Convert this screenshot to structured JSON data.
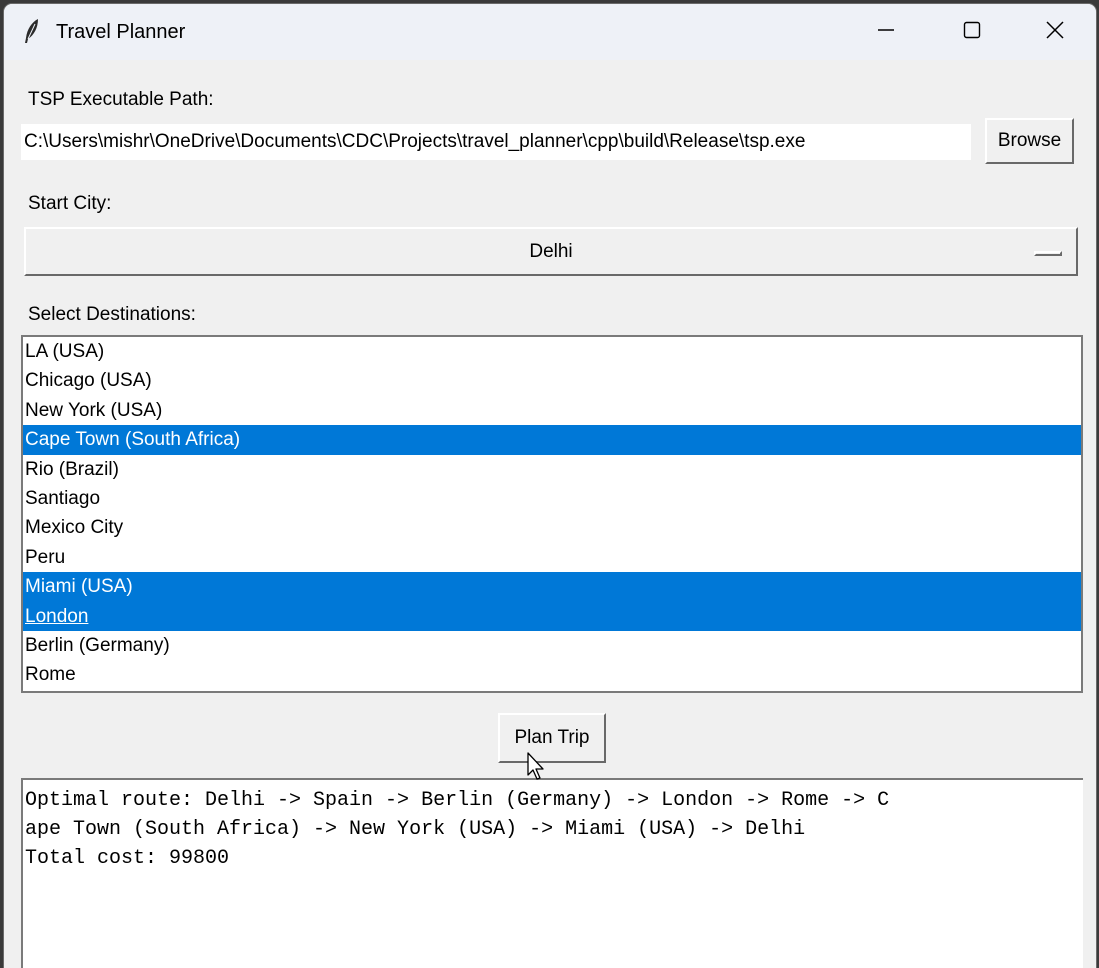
{
  "window": {
    "title": "Travel Planner",
    "icon": "feather-icon"
  },
  "tsp": {
    "label": "TSP Executable Path:",
    "path_value": "C:\\Users\\mishr\\OneDrive\\Documents\\CDC\\Projects\\travel_planner\\cpp\\build\\Release\\tsp.exe",
    "browse_label": "Browse"
  },
  "start_city": {
    "label": "Start City:",
    "selected": "Delhi"
  },
  "destinations": {
    "label": "Select Destinations:",
    "items": [
      {
        "label": "LA (USA)",
        "selected": false
      },
      {
        "label": "Chicago (USA)",
        "selected": false
      },
      {
        "label": "New York (USA)",
        "selected": false
      },
      {
        "label": "Cape Town (South Africa)",
        "selected": true
      },
      {
        "label": "Rio (Brazil)",
        "selected": false
      },
      {
        "label": "Santiago",
        "selected": false
      },
      {
        "label": "Mexico City",
        "selected": false
      },
      {
        "label": "Peru",
        "selected": false
      },
      {
        "label": "Miami (USA)",
        "selected": true
      },
      {
        "label": "London",
        "selected": true,
        "active": true
      },
      {
        "label": "Berlin (Germany)",
        "selected": false
      },
      {
        "label": "Rome",
        "selected": false
      }
    ],
    "selection_color": "#0078d7"
  },
  "plan_button_label": "Plan Trip",
  "output": {
    "line1": "Optimal route: Delhi -> Spain -> Berlin (Germany) -> London -> Rome -> C",
    "line2": "ape Town (South Africa) -> New York (USA) -> Miami (USA) -> Delhi",
    "line3": "Total cost: 99800"
  }
}
